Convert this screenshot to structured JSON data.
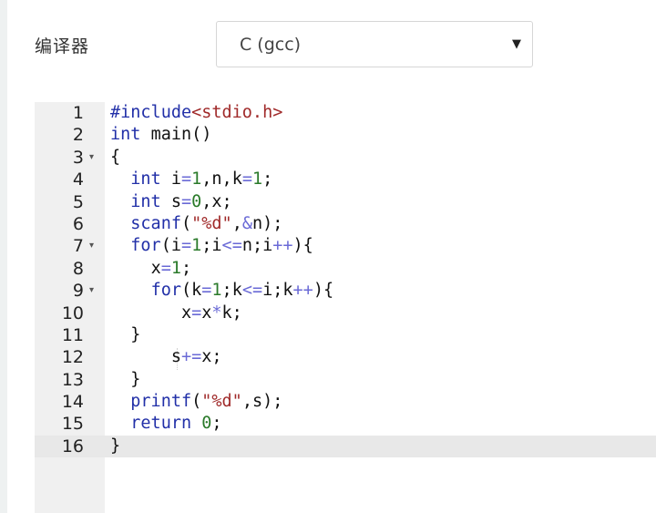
{
  "compiler": {
    "label": "编译器",
    "selected": "C (gcc)",
    "caret": "▼"
  },
  "editor": {
    "active_line": 16,
    "lines": [
      {
        "num": "1",
        "fold": false,
        "code": "#include<stdio.h>"
      },
      {
        "num": "2",
        "fold": false,
        "code": "int main()"
      },
      {
        "num": "3",
        "fold": true,
        "code": "{"
      },
      {
        "num": "4",
        "fold": false,
        "code": "  int i=1,n,k=1;"
      },
      {
        "num": "5",
        "fold": false,
        "code": "  int s=0,x;"
      },
      {
        "num": "6",
        "fold": false,
        "code": "  scanf(\"%d\",&n);"
      },
      {
        "num": "7",
        "fold": true,
        "code": "  for(i=1;i<=n;i++){"
      },
      {
        "num": "8",
        "fold": false,
        "code": "    x=1;"
      },
      {
        "num": "9",
        "fold": true,
        "code": "    for(k=1;k<=i;k++){"
      },
      {
        "num": "10",
        "fold": false,
        "code": "       x=x*k;"
      },
      {
        "num": "11",
        "fold": false,
        "code": "  }"
      },
      {
        "num": "12",
        "fold": false,
        "code": "      s+=x;"
      },
      {
        "num": "13",
        "fold": false,
        "code": "  }"
      },
      {
        "num": "14",
        "fold": false,
        "code": "  printf(\"%d\",s);"
      },
      {
        "num": "15",
        "fold": false,
        "code": "  return 0;"
      },
      {
        "num": "16",
        "fold": false,
        "code": "}"
      }
    ],
    "colors": {
      "keyword": "#2230a8",
      "string": "#a02a2a",
      "include_path": "#a02a2a",
      "operator": "#6a6ad6",
      "number": "#2a7a2a",
      "default": "#111111"
    }
  }
}
